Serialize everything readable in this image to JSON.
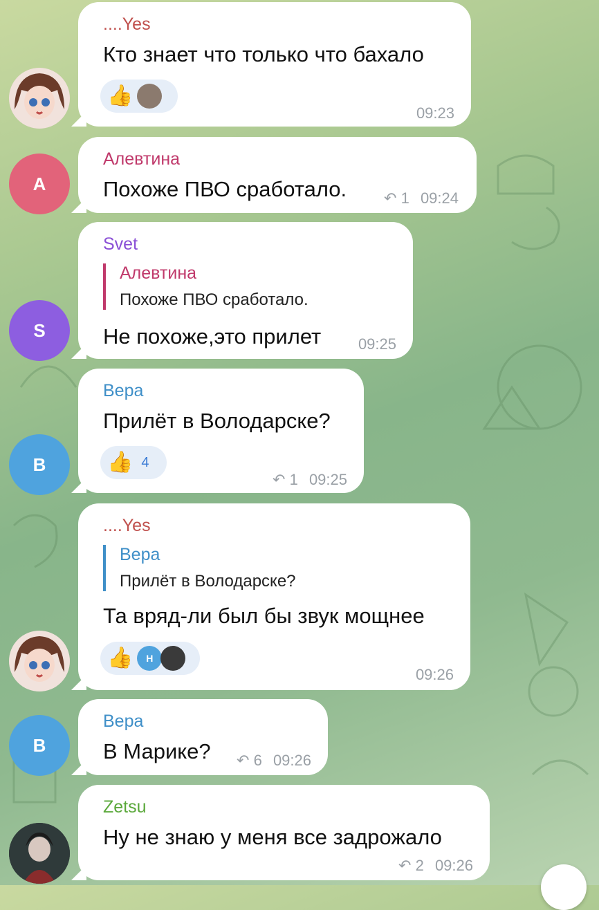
{
  "messages": [
    {
      "author": "....Yes",
      "author_color": "#c0504d",
      "text": "Кто знает что только что бахало",
      "time": "09:23",
      "reaction": {
        "emoji": "👍"
      }
    },
    {
      "author": "Алевтина",
      "author_color": "#c0396b",
      "avatar_letter": "A",
      "text": "Похоже ПВО сработало.",
      "replies": "1",
      "time": "09:24"
    },
    {
      "author": "Svet",
      "author_color": "#8a4fd6",
      "avatar_letter": "S",
      "quote_author": "Алевтина",
      "quote_text": "Похоже ПВО сработало.",
      "text": "Не похоже,это прилет",
      "time": "09:25"
    },
    {
      "author": "Вера",
      "author_color": "#3f8fc8",
      "avatar_letter": "B",
      "text": "Прилёт в Володарске?",
      "reaction": {
        "emoji": "👍",
        "count": "4"
      },
      "replies": "1",
      "time": "09:25"
    },
    {
      "author": "....Yes",
      "author_color": "#c0504d",
      "quote_author": "Вера",
      "quote_text": "Прилёт в Володарске?",
      "text": "Та вряд-ли был бы звук мощнее",
      "time": "09:26",
      "reaction": {
        "emoji": "👍",
        "reactor_letter": "H"
      }
    },
    {
      "author": "Вера",
      "author_color": "#3f8fc8",
      "avatar_letter": "B",
      "text": "В Марике?",
      "replies": "6",
      "time": "09:26"
    },
    {
      "author": "Zetsu",
      "author_color": "#5aa83a",
      "text": "Ну не знаю у меня все задрожало",
      "replies": "2",
      "time": "09:26"
    }
  ],
  "colors": {
    "avatar_a": "#e2637a",
    "avatar_s": "#8d5ee0",
    "avatar_b": "#4fa3de",
    "reaction_bg": "#e6eef8",
    "accent": "#3a7bd5"
  },
  "icons": [
    "reply-icon",
    "thumbs-up-icon",
    "scroll-down-button"
  ]
}
